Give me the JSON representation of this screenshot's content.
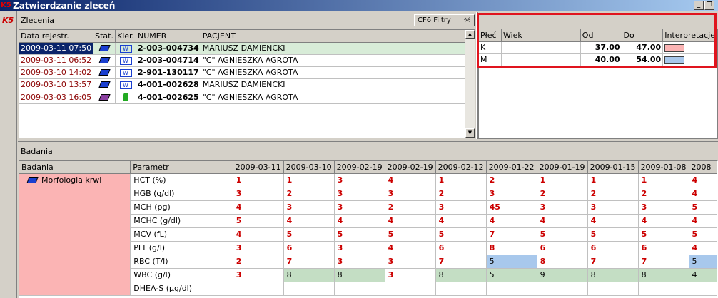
{
  "window": {
    "title": "Zatwierdzanie zleceń",
    "app_icon_label": "K5"
  },
  "zlecenia": {
    "caption": "Zlecenia",
    "filter_button_label": "CF6 Filtry",
    "columns": [
      "Data rejestr.",
      "Stat.",
      "Kier.",
      "NUMER",
      "PACJENT"
    ],
    "rows": [
      {
        "date": "2009-03-11 07:50",
        "status_icon": "book-icon",
        "kier_icon": "wjl-icon",
        "kier_text": "W",
        "number": "2-003-004734",
        "patient": "MARIUSZ DAMIENCKI",
        "selected": true
      },
      {
        "date": "2009-03-11 06:52",
        "status_icon": "book-icon",
        "kier_icon": "wjl-icon",
        "kier_text": "W",
        "number": "2-003-004714",
        "patient": "\"C\" AGNIESZKA AGROTA",
        "selected": false
      },
      {
        "date": "2009-03-10 14:02",
        "status_icon": "book-icon",
        "kier_icon": "wjl-icon",
        "kier_text": "W",
        "number": "2-901-130117",
        "patient": "\"C\" AGNIESZKA AGROTA",
        "selected": false
      },
      {
        "date": "2009-03-10 13:57",
        "status_icon": "book-icon",
        "kier_icon": "wjl-icon",
        "kier_text": "W",
        "number": "4-001-002628",
        "patient": "MARIUSZ DAMIENCKI",
        "selected": false
      },
      {
        "date": "2009-03-03 16:05",
        "status_icon": "book-purple-icon",
        "kier_icon": "person-icon",
        "kier_text": "",
        "number": "4-001-002625",
        "patient": "\"C\" AGNIESZKA AGROTA",
        "selected": false
      }
    ]
  },
  "norms": {
    "columns": [
      "Płeć",
      "Wiek",
      "Od",
      "Do",
      "Interpretacje"
    ],
    "rows": [
      {
        "sex": "K",
        "age": "",
        "from": "37.00",
        "to": "47.00",
        "color": "#fbb4b4"
      },
      {
        "sex": "M",
        "age": "",
        "from": "40.00",
        "to": "54.00",
        "color": "#a8c8ec"
      }
    ]
  },
  "badania": {
    "caption": "Badania",
    "columns": [
      "Badania",
      "Parametr",
      "2009-03-11",
      "2009-03-10",
      "2009-02-19",
      "2009-02-19",
      "2009-02-12",
      "2009-01-22",
      "2009-01-19",
      "2009-01-15",
      "2009-01-08",
      "2008"
    ],
    "category": "Morfologia krwi",
    "rows": [
      {
        "param": "HCT (%)",
        "values": [
          "1",
          "1",
          "3",
          "4",
          "1",
          "2",
          "1",
          "1",
          "1",
          "4"
        ],
        "styles": [
          "r",
          "r",
          "r",
          "r",
          "r",
          "r",
          "r",
          "r",
          "r",
          "r"
        ]
      },
      {
        "param": "HGB (g/dl)",
        "values": [
          "3",
          "2",
          "3",
          "3",
          "2",
          "3",
          "2",
          "2",
          "2",
          "4"
        ],
        "styles": [
          "r",
          "r",
          "r",
          "r",
          "r",
          "r",
          "r",
          "r",
          "r",
          "r"
        ]
      },
      {
        "param": "MCH (pg)",
        "values": [
          "4",
          "3",
          "3",
          "2",
          "3",
          "45",
          "3",
          "3",
          "3",
          "5"
        ],
        "styles": [
          "r",
          "r",
          "r",
          "r",
          "r",
          "r",
          "r",
          "r",
          "r",
          "r"
        ]
      },
      {
        "param": "MCHC (g/dl)",
        "values": [
          "5",
          "4",
          "4",
          "4",
          "4",
          "4",
          "4",
          "4",
          "4",
          "4"
        ],
        "styles": [
          "r",
          "r",
          "r",
          "r",
          "r",
          "r",
          "r",
          "r",
          "r",
          "r"
        ]
      },
      {
        "param": "MCV (fL)",
        "values": [
          "4",
          "5",
          "5",
          "5",
          "5",
          "7",
          "5",
          "5",
          "5",
          "5"
        ],
        "styles": [
          "r",
          "r",
          "r",
          "r",
          "r",
          "r",
          "r",
          "r",
          "r",
          "r"
        ]
      },
      {
        "param": "PLT (g/l)",
        "values": [
          "3",
          "6",
          "3",
          "4",
          "6",
          "8",
          "6",
          "6",
          "6",
          "4"
        ],
        "styles": [
          "r",
          "r",
          "r",
          "r",
          "r",
          "r",
          "r",
          "r",
          "r",
          "r"
        ]
      },
      {
        "param": "RBC (T/l)",
        "values": [
          "2",
          "7",
          "3",
          "3",
          "7",
          "5",
          "8",
          "7",
          "7",
          "5"
        ],
        "styles": [
          "r",
          "r",
          "r",
          "r",
          "r",
          "b",
          "r",
          "r",
          "r",
          "b"
        ]
      },
      {
        "param": "WBC (g/l)",
        "values": [
          "3",
          "8",
          "8",
          "3",
          "8",
          "5",
          "9",
          "8",
          "8",
          "4"
        ],
        "styles": [
          "r",
          "g",
          "g",
          "r",
          "g",
          "g",
          "g",
          "g",
          "g",
          "g"
        ]
      },
      {
        "param": "DHEA-S (µg/dl)",
        "values": [
          "",
          "",
          "",
          "",
          "",
          "",
          "",
          "",
          "",
          ""
        ],
        "styles": [
          "n",
          "n",
          "n",
          "n",
          "n",
          "n",
          "n",
          "n",
          "n",
          "n"
        ]
      }
    ]
  }
}
